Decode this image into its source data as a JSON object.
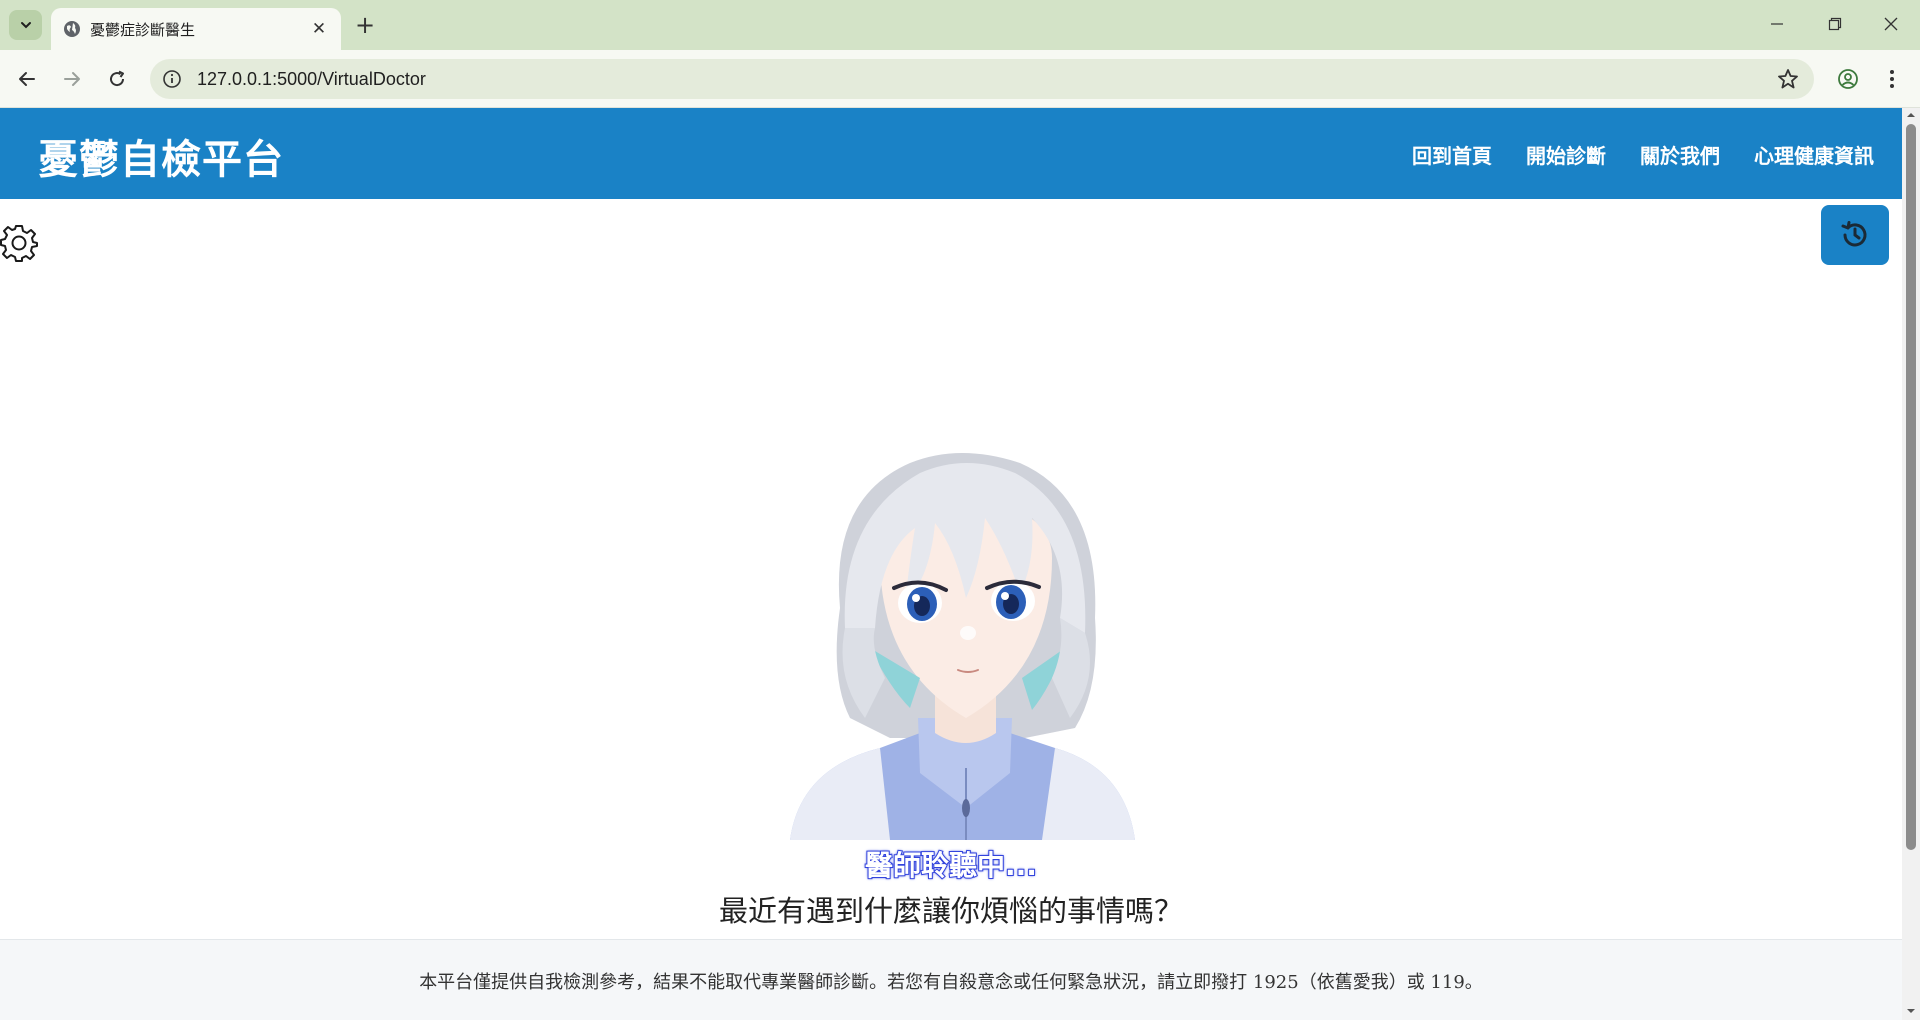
{
  "browser": {
    "tab_title": "憂鬱症診斷醫生",
    "url_host": "127.0.0.1",
    "url_path": ":5000/VirtualDoctor",
    "new_tab_label": "+",
    "close_tab_label": "✕"
  },
  "header": {
    "logo": "憂鬱自檢平台",
    "nav": [
      "回到首頁",
      "開始診斷",
      "關於我們",
      "心理健康資訊"
    ]
  },
  "main": {
    "status": "醫師聆聽中...",
    "question": "最近有遇到什麼讓你煩惱的事情嗎？"
  },
  "footer": {
    "disclaimer": "本平台僅提供自我檢測參考，結果不能取代專業醫師診斷。若您有自殺意念或任何緊急狀況，請立即撥打 1925（依舊愛我）或 119。"
  },
  "colors": {
    "brand": "#1a82c6",
    "status_outline": "#3344dd"
  },
  "icons": {
    "settings": "gear-icon",
    "history": "history-icon"
  }
}
